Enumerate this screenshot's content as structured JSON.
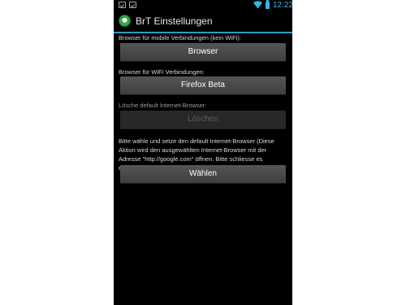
{
  "status_bar": {
    "clock": "12:22",
    "notification_icons": [
      "notification-icon",
      "notification-icon"
    ],
    "wifi_icon": "wifi-icon",
    "battery_icon": "battery-icon",
    "accent_color": "#33b5e5"
  },
  "action_bar": {
    "app_icon": "recycle-app-icon",
    "title": "BrT Einstellungen"
  },
  "settings": {
    "mobile_label": "Browser für mobile Verbindungen (kein WiFi):",
    "mobile_button": "Browser",
    "wifi_label": "Browser für WiFi Verbindungen:",
    "wifi_button": "Firefox Beta",
    "delete_label": "Lösche default Internet-Browser:",
    "delete_button": "Löschen",
    "choose_description": "Bitte wähle und setze den default Internet-Browser (Diese Aktion wird den ausgewählten Internet-Browser mit der Adresse \"http://google.com\" öffnen. Bitte schliesse es einfach.):",
    "choose_button": "Wählen"
  }
}
